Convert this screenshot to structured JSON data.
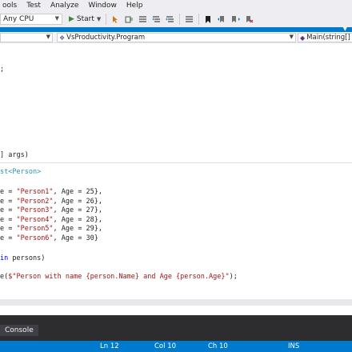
{
  "menu": {
    "items": [
      "ools",
      "Test",
      "Analyze",
      "Window",
      "Help"
    ]
  },
  "toolbar": {
    "platform": "Any CPU",
    "start_label": "Start",
    "icons": [
      "cursor-icon",
      "attach-icon",
      "list-icon",
      "align-left-icon",
      "align-right-icon",
      "comment-icon",
      "bookmark-icon",
      "bookmark-prev-icon",
      "bookmark-next-icon",
      "bookmark-clear-icon"
    ]
  },
  "navbar": {
    "project": "",
    "class": "VsProductivity.Program",
    "member": "Main(string[]"
  },
  "code": {
    "line1": ";",
    "line_args_a": "] ",
    "line_args_b": "args)",
    "list_a": "st<",
    "list_b": "Person",
    "list_c": ">",
    "persons": [
      {
        "pre": "e = ",
        "name": "\"Person1\"",
        "mid": ", Age = ",
        "age": "25",
        "post": "},"
      },
      {
        "pre": "e = ",
        "name": "\"Person2\"",
        "mid": ", Age = ",
        "age": "26",
        "post": "},"
      },
      {
        "pre": "e = ",
        "name": "\"Person3\"",
        "mid": ", Age = ",
        "age": "27",
        "post": "},"
      },
      {
        "pre": "e = ",
        "name": "\"Person4\"",
        "mid": ", Age = ",
        "age": "28",
        "post": "},"
      },
      {
        "pre": "e = ",
        "name": "\"Person5\"",
        "mid": ", Age = ",
        "age": "29",
        "post": "},"
      },
      {
        "pre": "e = ",
        "name": "\"Person6\"",
        "mid": ", Age = ",
        "age": "30",
        "post": "}"
      }
    ],
    "foreach_kw": "in",
    "foreach_rest": " persons)",
    "write_a": "e(",
    "write_str": "$\"Person with name {person.Name} and Age {person.Age}\"",
    "write_b": ");"
  },
  "panel": {
    "tab_label": "Console"
  },
  "status": {
    "ln": "Ln 12",
    "col": "Col 10",
    "ch": "Ch 10",
    "mode": "INS"
  },
  "colors": {
    "accent": "#007acc",
    "keyword": "#0000ff",
    "type": "#2b91af",
    "string": "#a31515"
  }
}
